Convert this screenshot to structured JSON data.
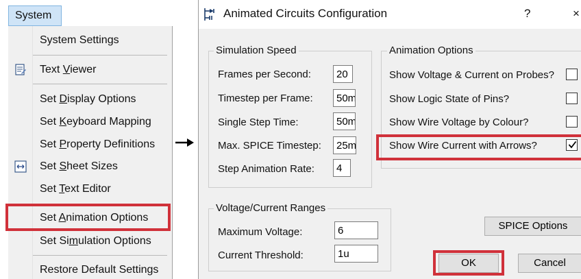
{
  "menu": {
    "title": "System",
    "items": [
      {
        "label": "System Settings"
      },
      {
        "pre": "Text ",
        "u": "V",
        "post": "iewer"
      },
      {
        "pre": "Set ",
        "u": "D",
        "post": "isplay Options"
      },
      {
        "pre": "Set ",
        "u": "K",
        "post": "eyboard Mapping"
      },
      {
        "pre": "Set ",
        "u": "P",
        "post": "roperty Definitions"
      },
      {
        "pre": "Set ",
        "u": "S",
        "post": "heet Sizes"
      },
      {
        "pre": "Set ",
        "u": "T",
        "post": "ext Editor"
      },
      {
        "pre": "Set ",
        "u": "A",
        "post": "nimation Options"
      },
      {
        "pre": "Set Si",
        "u": "m",
        "post": "ulation Options"
      },
      {
        "label": "Restore Default Settings"
      }
    ]
  },
  "dialog": {
    "title": "Animated Circuits Configuration",
    "help": "?",
    "close": "×",
    "simulation_speed": {
      "label": "Simulation Speed",
      "fields": [
        {
          "label": "Frames per Second:",
          "value": "20"
        },
        {
          "label": "Timestep per Frame:",
          "value": "50m"
        },
        {
          "label": "Single Step Time:",
          "value": "50m"
        },
        {
          "label": "Max. SPICE Timestep:",
          "value": "25m"
        },
        {
          "label": "Step Animation Rate:",
          "value": "4"
        }
      ]
    },
    "ranges": {
      "label": "Voltage/Current Ranges",
      "fields": [
        {
          "label": "Maximum Voltage:",
          "value": "6"
        },
        {
          "label": "Current Threshold:",
          "value": "1u"
        }
      ]
    },
    "animation_options": {
      "label": "Animation Options",
      "options": [
        {
          "label": "Show Voltage & Current on Probes?",
          "checked": false
        },
        {
          "label": "Show Logic State of Pins?",
          "checked": false
        },
        {
          "label": "Show Wire Voltage by Colour?",
          "checked": false
        },
        {
          "label": "Show Wire Current with Arrows?",
          "checked": true
        }
      ]
    },
    "buttons": {
      "spice": "SPICE Options",
      "ok": "OK",
      "cancel": "Cancel"
    }
  },
  "colors": {
    "highlight": "#d0313a",
    "menu_bar_selected": "#cfe4f7"
  }
}
